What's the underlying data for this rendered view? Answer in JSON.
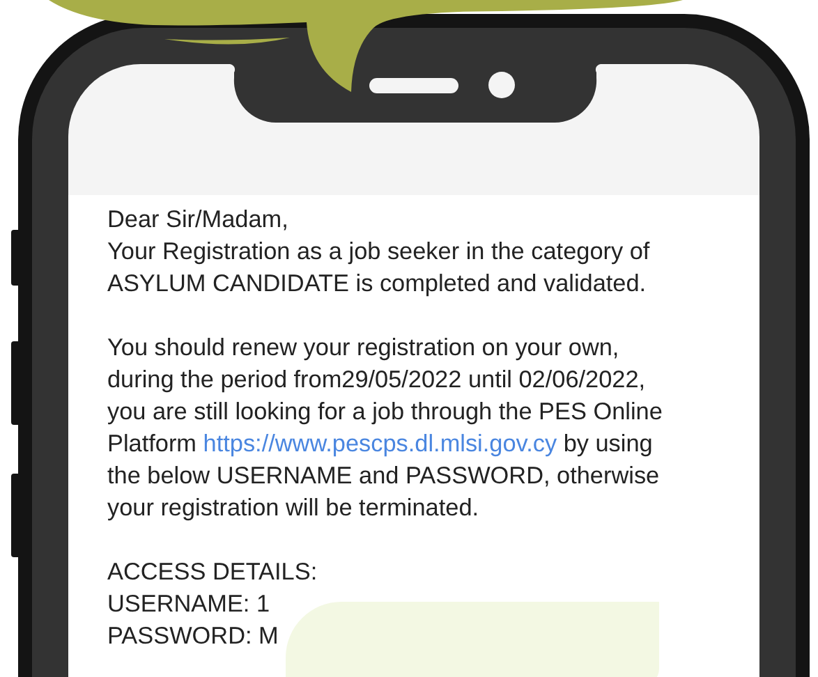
{
  "message": {
    "greeting": "Dear Sir/Madam,",
    "paragraphs": [
      {
        "lines": [
          [
            {
              "text": "Your Registration as a job seeker in the category of"
            }
          ],
          [
            {
              "text": "ASYLUM CANDIDATE is completed and validated."
            }
          ]
        ]
      },
      {
        "lines": [
          [
            {
              "text": "You should renew your registration on your own,"
            }
          ],
          [
            {
              "text": "during the period from29/05/2022 until 02/06/2022,"
            }
          ],
          [
            {
              "text": "you are still looking for a job through the PES Online"
            }
          ],
          [
            {
              "text": "Platform "
            },
            {
              "text": "https://www.pescps.dl.mlsi.gov.cy",
              "kind": "link"
            },
            {
              "text": " by using"
            }
          ],
          [
            {
              "text": "the below USERNAME and PASSWORD, otherwise"
            }
          ],
          [
            {
              "text": "your registration will be terminated."
            }
          ]
        ]
      }
    ],
    "access": {
      "heading": "ACCESS DETAILS:",
      "fields": [
        {
          "label": "USERNAME: 1"
        },
        {
          "label": "PASSWORD: M"
        }
      ]
    }
  }
}
